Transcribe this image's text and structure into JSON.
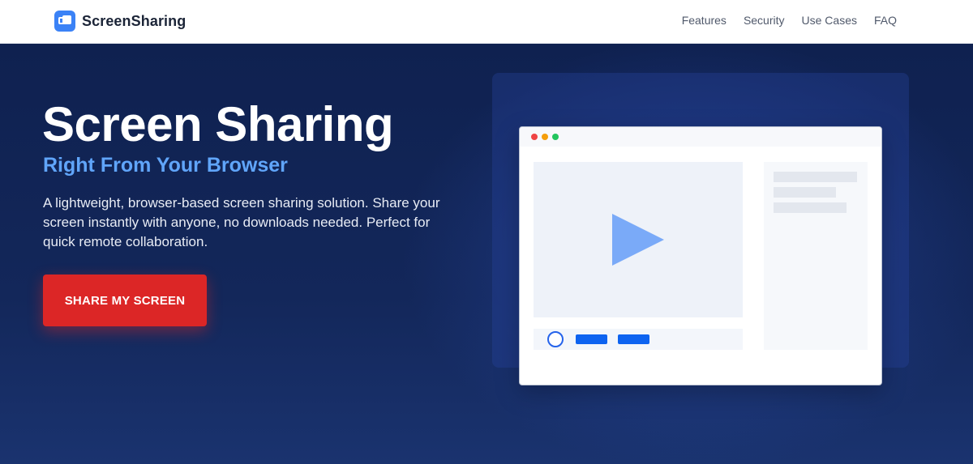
{
  "header": {
    "brand_name": "ScreenSharing",
    "brand_icon": "screens-icon",
    "nav": [
      "Features",
      "Security",
      "Use Cases",
      "FAQ"
    ]
  },
  "hero": {
    "title": "Screen Sharing",
    "subtitle": "Right From Your Browser",
    "description": "A lightweight, browser-based screen sharing solution. Share your screen instantly with anyone, no downloads needed. Perfect for quick remote collaboration.",
    "cta_label": "SHARE MY SCREEN"
  },
  "colors": {
    "accent_blue": "#60a5fa",
    "cta_red": "#dc2626",
    "hero_background": "#0f2150",
    "brand_icon_blue": "#3b82f6"
  },
  "illustration": {
    "window_dots": [
      "#ef4444",
      "#f59e0b",
      "#22c55e"
    ],
    "video_icon": "play-icon"
  }
}
